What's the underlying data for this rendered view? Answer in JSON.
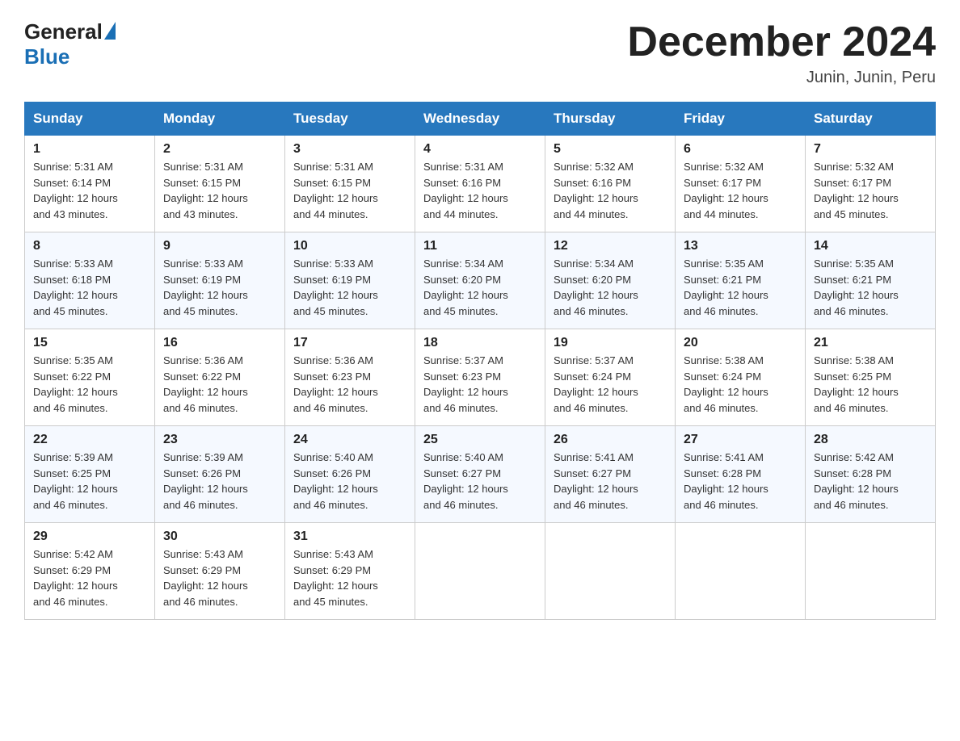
{
  "logo": {
    "general": "General",
    "blue": "Blue"
  },
  "title": "December 2024",
  "subtitle": "Junin, Junin, Peru",
  "days_of_week": [
    "Sunday",
    "Monday",
    "Tuesday",
    "Wednesday",
    "Thursday",
    "Friday",
    "Saturday"
  ],
  "weeks": [
    [
      {
        "num": "1",
        "sunrise": "5:31 AM",
        "sunset": "6:14 PM",
        "daylight": "12 hours and 43 minutes."
      },
      {
        "num": "2",
        "sunrise": "5:31 AM",
        "sunset": "6:15 PM",
        "daylight": "12 hours and 43 minutes."
      },
      {
        "num": "3",
        "sunrise": "5:31 AM",
        "sunset": "6:15 PM",
        "daylight": "12 hours and 44 minutes."
      },
      {
        "num": "4",
        "sunrise": "5:31 AM",
        "sunset": "6:16 PM",
        "daylight": "12 hours and 44 minutes."
      },
      {
        "num": "5",
        "sunrise": "5:32 AM",
        "sunset": "6:16 PM",
        "daylight": "12 hours and 44 minutes."
      },
      {
        "num": "6",
        "sunrise": "5:32 AM",
        "sunset": "6:17 PM",
        "daylight": "12 hours and 44 minutes."
      },
      {
        "num": "7",
        "sunrise": "5:32 AM",
        "sunset": "6:17 PM",
        "daylight": "12 hours and 45 minutes."
      }
    ],
    [
      {
        "num": "8",
        "sunrise": "5:33 AM",
        "sunset": "6:18 PM",
        "daylight": "12 hours and 45 minutes."
      },
      {
        "num": "9",
        "sunrise": "5:33 AM",
        "sunset": "6:19 PM",
        "daylight": "12 hours and 45 minutes."
      },
      {
        "num": "10",
        "sunrise": "5:33 AM",
        "sunset": "6:19 PM",
        "daylight": "12 hours and 45 minutes."
      },
      {
        "num": "11",
        "sunrise": "5:34 AM",
        "sunset": "6:20 PM",
        "daylight": "12 hours and 45 minutes."
      },
      {
        "num": "12",
        "sunrise": "5:34 AM",
        "sunset": "6:20 PM",
        "daylight": "12 hours and 46 minutes."
      },
      {
        "num": "13",
        "sunrise": "5:35 AM",
        "sunset": "6:21 PM",
        "daylight": "12 hours and 46 minutes."
      },
      {
        "num": "14",
        "sunrise": "5:35 AM",
        "sunset": "6:21 PM",
        "daylight": "12 hours and 46 minutes."
      }
    ],
    [
      {
        "num": "15",
        "sunrise": "5:35 AM",
        "sunset": "6:22 PM",
        "daylight": "12 hours and 46 minutes."
      },
      {
        "num": "16",
        "sunrise": "5:36 AM",
        "sunset": "6:22 PM",
        "daylight": "12 hours and 46 minutes."
      },
      {
        "num": "17",
        "sunrise": "5:36 AM",
        "sunset": "6:23 PM",
        "daylight": "12 hours and 46 minutes."
      },
      {
        "num": "18",
        "sunrise": "5:37 AM",
        "sunset": "6:23 PM",
        "daylight": "12 hours and 46 minutes."
      },
      {
        "num": "19",
        "sunrise": "5:37 AM",
        "sunset": "6:24 PM",
        "daylight": "12 hours and 46 minutes."
      },
      {
        "num": "20",
        "sunrise": "5:38 AM",
        "sunset": "6:24 PM",
        "daylight": "12 hours and 46 minutes."
      },
      {
        "num": "21",
        "sunrise": "5:38 AM",
        "sunset": "6:25 PM",
        "daylight": "12 hours and 46 minutes."
      }
    ],
    [
      {
        "num": "22",
        "sunrise": "5:39 AM",
        "sunset": "6:25 PM",
        "daylight": "12 hours and 46 minutes."
      },
      {
        "num": "23",
        "sunrise": "5:39 AM",
        "sunset": "6:26 PM",
        "daylight": "12 hours and 46 minutes."
      },
      {
        "num": "24",
        "sunrise": "5:40 AM",
        "sunset": "6:26 PM",
        "daylight": "12 hours and 46 minutes."
      },
      {
        "num": "25",
        "sunrise": "5:40 AM",
        "sunset": "6:27 PM",
        "daylight": "12 hours and 46 minutes."
      },
      {
        "num": "26",
        "sunrise": "5:41 AM",
        "sunset": "6:27 PM",
        "daylight": "12 hours and 46 minutes."
      },
      {
        "num": "27",
        "sunrise": "5:41 AM",
        "sunset": "6:28 PM",
        "daylight": "12 hours and 46 minutes."
      },
      {
        "num": "28",
        "sunrise": "5:42 AM",
        "sunset": "6:28 PM",
        "daylight": "12 hours and 46 minutes."
      }
    ],
    [
      {
        "num": "29",
        "sunrise": "5:42 AM",
        "sunset": "6:29 PM",
        "daylight": "12 hours and 46 minutes."
      },
      {
        "num": "30",
        "sunrise": "5:43 AM",
        "sunset": "6:29 PM",
        "daylight": "12 hours and 46 minutes."
      },
      {
        "num": "31",
        "sunrise": "5:43 AM",
        "sunset": "6:29 PM",
        "daylight": "12 hours and 45 minutes."
      },
      null,
      null,
      null,
      null
    ]
  ],
  "labels": {
    "sunrise": "Sunrise:",
    "sunset": "Sunset:",
    "daylight": "Daylight:"
  }
}
